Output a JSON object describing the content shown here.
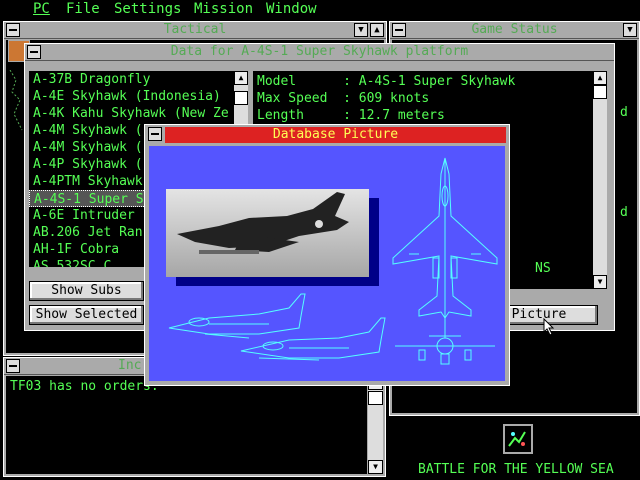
{
  "menu": {
    "items": [
      "PC",
      "File",
      "Settings",
      "Mission",
      "Window"
    ]
  },
  "tactical": {
    "title": "Tactical"
  },
  "game_status": {
    "title": "Game Status",
    "edge_chars": [
      "d",
      "d"
    ]
  },
  "data_window": {
    "title": "Data for A-4S-1 Super Skyhawk platform",
    "list_items": [
      "A-37B Dragonfly",
      "A-4E Skyhawk (Indonesia)",
      "A-4K Kahu Skyhawk (New Ze",
      "A-4M Skyhawk (",
      "A-4M Skyhawk (",
      "A-4P Skyhawk (",
      "A-4PTM Skyhawk",
      "A-4S-1 Super S",
      "A-6E Intruder",
      "AB.206 Jet Ran",
      "AH-1F Cobra",
      "AS 532SC C"
    ],
    "selected_index": 7,
    "details": [
      "Model      : A-4S-1 Super Skyhawk",
      "Max Speed  : 609 knots",
      "Length     : 12.7 meters"
    ],
    "details_tail": "NS",
    "show_subs_label": "Show Subs",
    "show_selected_label": "Show Selected",
    "picture_label": "Picture"
  },
  "database_picture": {
    "title": "Database Picture"
  },
  "incoming": {
    "title": "Inc",
    "message": "TF03 has no orders."
  },
  "footer": {
    "scenario": "BATTLE FOR THE YELLOW SEA"
  },
  "colors": {
    "desktop": "#000000",
    "frame": "#aaaaaa",
    "text_green": "#55ff55",
    "title_green": "#55aa55",
    "active_title": "#dd2222",
    "active_title_text": "#ffff55",
    "picture_bg": "#5555ff",
    "wireframe": "#55ffff",
    "selection": "#aaaaaa"
  }
}
